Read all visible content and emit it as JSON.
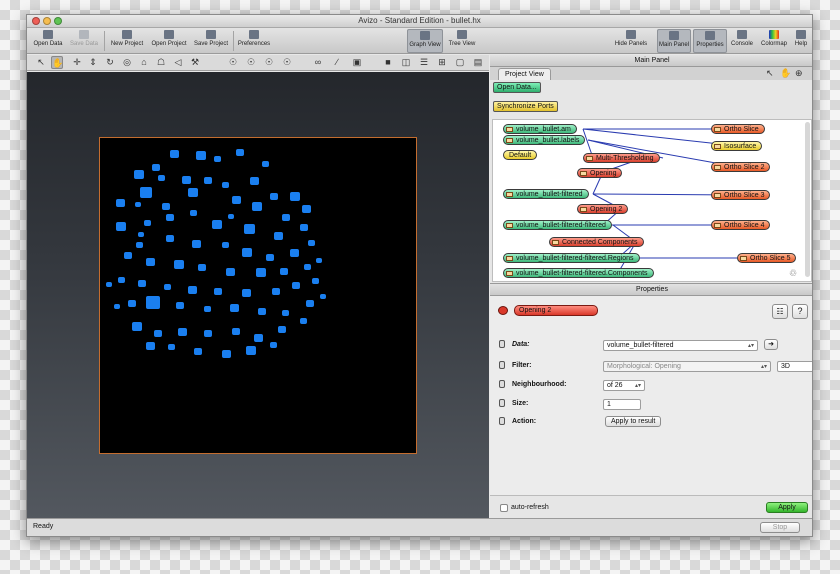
{
  "window": {
    "title": "Avizo - Standard Edition - bullet.hx",
    "controls": {
      "close_color": "#ee5f57",
      "minimize_color": "#f5bd4f",
      "zoom_color": "#5fc454"
    }
  },
  "toolbar": {
    "open_data": "Open Data",
    "save_data": "Save Data",
    "new_project": "New Project",
    "open_project": "Open Project",
    "save_project": "Save Project",
    "preferences": "Preferences",
    "graph_view": "Graph View",
    "tree_view": "Tree View",
    "hide_panels": "Hide Panels",
    "main_panel": "Main Panel",
    "properties": "Properties",
    "console": "Console",
    "colormap": "Colormap",
    "help": "Help"
  },
  "viewer_toolbar": {
    "icons": [
      "pointer-icon",
      "interact-icon",
      "translate-icon",
      "zoom-icon",
      "rotate-icon",
      "trackball-icon",
      "home-icon",
      "set-home-icon",
      "view-all-icon",
      "measure-icon",
      "perspective-icon",
      "orthographic-icon",
      "snapshot-icon",
      "layout-1-icon",
      "layout-2-icon",
      "layout-3-icon",
      "layout-4-icon",
      "fullscreen-icon",
      "layout-5-icon"
    ]
  },
  "main_panel": {
    "title": "Main Panel",
    "tab": "Project View",
    "open_data_button": "Open Data...",
    "sync_ports_button": "Synchronize Ports",
    "nodes": {
      "volume_bullet_am": "volume_bullet.am",
      "volume_bullet_labels": "volume_bullet.labels",
      "default": "Default",
      "multi_thresholding": "Multi-Thresholding",
      "opening": "Opening",
      "volume_bullet_filtered": "volume_bullet-filtered",
      "opening_2": "Opening 2",
      "volume_bullet_filtered_filtered": "volume_bullet-filtered-filtered",
      "connected_components": "Connected Components",
      "regions": "volume_bullet-filtered-filtered.Regions",
      "components": "volume_bullet-filtered-filtered.Components",
      "ortho_slice": "Ortho Slice",
      "isosurface": "Isosurface",
      "ortho_slice_2": "Ortho Slice 2",
      "ortho_slice_3": "Ortho Slice 3",
      "ortho_slice_4": "Ortho Slice 4",
      "ortho_slice_5": "Ortho Slice 5"
    }
  },
  "properties_panel": {
    "title": "Properties",
    "module_name": "Opening 2",
    "data_label": "Data:",
    "data_value": "volume_bullet-filtered",
    "filter_label": "Filter:",
    "filter_value": "Morphological: Opening",
    "filter_dim": "3D",
    "neighbourhood_label": "Neighbourhood:",
    "neighbourhood_value": "of 26",
    "size_label": "Size:",
    "size_value": "1",
    "action_label": "Action:",
    "action_button": "Apply to result",
    "auto_refresh": "auto-refresh",
    "apply_button": "Apply"
  },
  "status": {
    "text": "Ready",
    "stop_button": "Stop"
  },
  "colors": {
    "spot": "#1a7ff0",
    "canvas_border": "#c46d2f",
    "data_node": "#3fb87b",
    "compute_node": "#d9402e",
    "display_node": "#e85a28",
    "apply_button": "#3fbe3a"
  }
}
